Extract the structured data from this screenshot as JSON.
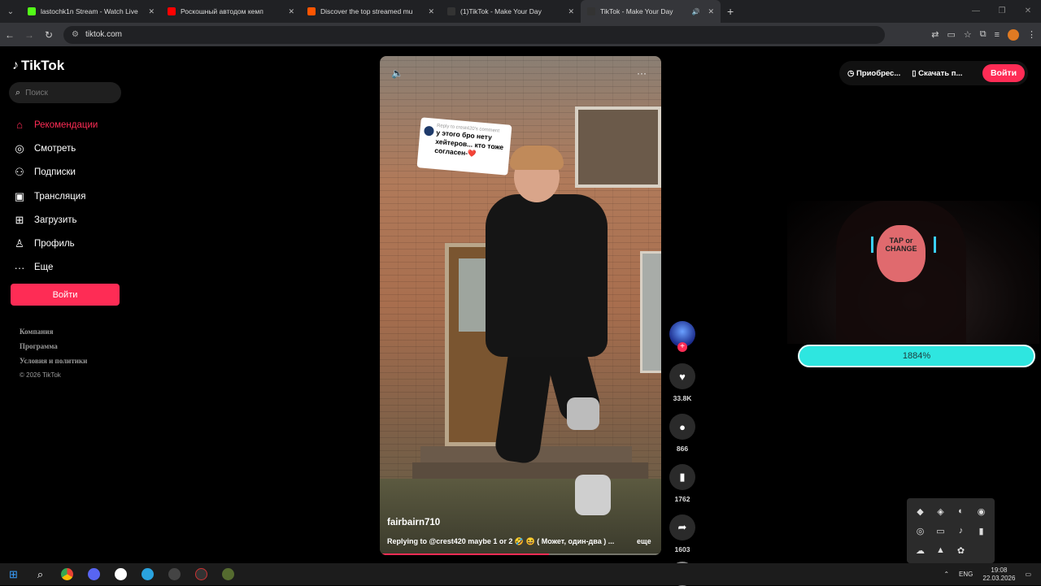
{
  "browser": {
    "tabs": [
      {
        "title": "lastochk1n Stream - Watch Live",
        "color": "#53fc18"
      },
      {
        "title": "Роскошный автодом кемп",
        "color": "#ff0000"
      },
      {
        "title": "Discover the top streamed mu",
        "color": "#ff5500"
      },
      {
        "title": "(1)TikTok - Make Your Day",
        "color": "#000000"
      },
      {
        "title": "TikTok - Make Your Day",
        "color": "#000000"
      }
    ],
    "url": "tiktok.com"
  },
  "sidebar": {
    "logo": "TikTok",
    "search_placeholder": "Поиск",
    "menu": [
      {
        "label": "Рекомендации",
        "icon": "home-icon",
        "glyph": "⌂"
      },
      {
        "label": "Смотреть",
        "icon": "compass-icon",
        "glyph": "◎"
      },
      {
        "label": "Подписки",
        "icon": "following-icon",
        "glyph": "⚇"
      },
      {
        "label": "Трансляция",
        "icon": "live-icon",
        "glyph": "▣"
      },
      {
        "label": "Загрузить",
        "icon": "upload-icon",
        "glyph": "⊞"
      },
      {
        "label": "Профиль",
        "icon": "profile-icon",
        "glyph": "♙"
      },
      {
        "label": "Еще",
        "icon": "more-icon",
        "glyph": "···"
      }
    ],
    "login": "Войти",
    "footer": {
      "company": "Компания",
      "program": "Программа",
      "terms": "Условия и политики",
      "copyright": "© 2026 TikTok"
    }
  },
  "video": {
    "reply_header": "Reply to crest420's comment",
    "reply_text": "у этого бро нету хейтеров... кто тоже согласен-❤️",
    "username": "fairbairn710",
    "caption": "Replying to @crest420 maybe 1 or 2 🤣 😆 ( Может, один-два ) ...",
    "more": "еще",
    "progress": 0.6
  },
  "actions": {
    "likes": "33.8K",
    "comments": "866",
    "saves": "1762",
    "shares": "1603"
  },
  "topright": {
    "acquire": "Приобрес...",
    "download": "Скачать п...",
    "login": "Войти"
  },
  "overlay": {
    "mask_text": "TAP or CHANGE",
    "goal": "1884%"
  },
  "taskbar": {
    "lang": "ENG",
    "time": "19:08",
    "date": "22.03.2026"
  },
  "colors": {
    "accent": "#fe2c55",
    "goal": "#2ee6e0"
  }
}
